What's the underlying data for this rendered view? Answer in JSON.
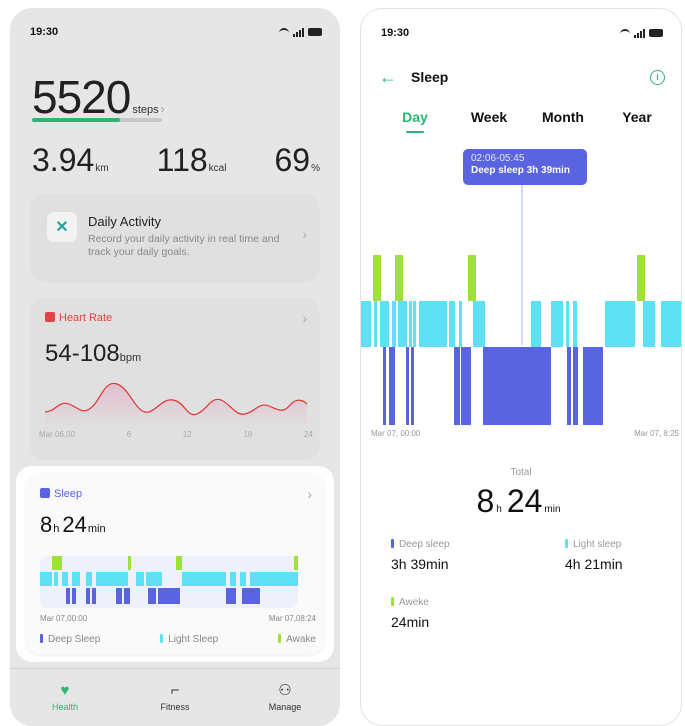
{
  "status_time": "19:30",
  "colors": {
    "accent": "#2bb673",
    "deep": "#5a63e0",
    "light": "#5ee0f5",
    "awake": "#9ee03c",
    "heart": "#d44"
  },
  "left": {
    "steps": {
      "value": "5520",
      "unit": "steps",
      "progress": 0.68
    },
    "stats": [
      {
        "value": "3.94",
        "unit": "km"
      },
      {
        "value": "118",
        "unit": "kcal"
      },
      {
        "value": "69",
        "unit": "%"
      }
    ],
    "daily_activity": {
      "title": "Daily Activity",
      "description": "Record your daily activity in real time and track your daily goals.",
      "icon": "activity-icon"
    },
    "heart_rate": {
      "label": "Heart Rate",
      "value": "54-108",
      "unit": "bpm",
      "axis": [
        "Mar 06,00",
        "6",
        "12",
        "18",
        "24"
      ]
    },
    "sleep": {
      "label": "Sleep",
      "hours": "8",
      "h_unit": "h",
      "minutes": "24",
      "min_unit": "min",
      "axis_start": "Mar 07,00:00",
      "axis_end": "Mar 07,08:24",
      "legend": {
        "deep": "Deep Sleep",
        "light": "Light Sleep",
        "awake": "Awake"
      }
    },
    "nav": [
      {
        "label": "Health",
        "icon": "heart-icon"
      },
      {
        "label": "Fitness",
        "icon": "shoe-icon"
      },
      {
        "label": "Manage",
        "icon": "person-icon"
      }
    ]
  },
  "right": {
    "title": "Sleep",
    "tabs": [
      "Day",
      "Week",
      "Month",
      "Year"
    ],
    "active_tab": "Day",
    "tooltip": {
      "time": "02:06-05:45",
      "text": "Deep sleep 3h 39min"
    },
    "axis_start": "Mar 07, 00:00",
    "axis_end": "Mar 07, 8:25",
    "total_label": "Total",
    "total": {
      "hours": "8",
      "h_unit": "h",
      "minutes": "24",
      "min_unit": "min"
    },
    "deep": {
      "label": "Deep sleep",
      "value": "3h 39min"
    },
    "light": {
      "label": "Light sleep",
      "value": "4h 21min"
    },
    "awake": {
      "label": "Aweke",
      "value": "24min"
    }
  }
}
